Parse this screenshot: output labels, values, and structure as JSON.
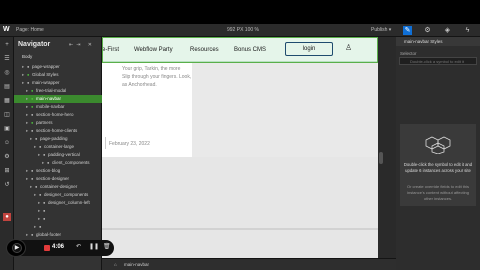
{
  "topbar": {
    "page_label": "Page: Home",
    "sizes": "992 PX  100 %",
    "publish": "Publish ▾"
  },
  "navigator": {
    "title": "Navigator",
    "body_label": "Body",
    "rows": [
      {
        "label": "page-wrapper",
        "dot": "w",
        "depth": 1
      },
      {
        "label": "Global Styles",
        "dot": "g",
        "depth": 1
      },
      {
        "label": "main-wrapper",
        "dot": "w",
        "depth": 1
      },
      {
        "label": "free-trial-modal",
        "dot": "g",
        "depth": 2
      },
      {
        "label": "main-navbar",
        "dot": "g",
        "depth": 2,
        "selected": true
      },
      {
        "label": "mobile-navbar",
        "dot": "g",
        "depth": 2
      },
      {
        "label": "section-home-hero",
        "dot": "w",
        "depth": 2
      },
      {
        "label": "partners",
        "dot": "g",
        "depth": 2
      },
      {
        "label": "section-home-clients",
        "dot": "w",
        "depth": 2
      },
      {
        "label": "page-padding",
        "dot": "w",
        "depth": 3
      },
      {
        "label": "container-large",
        "dot": "w",
        "depth": 4
      },
      {
        "label": "padding-vertical",
        "dot": "w",
        "depth": 5
      },
      {
        "label": "client_components",
        "dot": "w",
        "depth": 6
      },
      {
        "label": "section-blog",
        "dot": "w",
        "depth": 2
      },
      {
        "label": "section-designer",
        "dot": "w",
        "depth": 2
      },
      {
        "label": "container-designer",
        "dot": "w",
        "depth": 3
      },
      {
        "label": "designer_components",
        "dot": "w",
        "depth": 4
      },
      {
        "label": "designer_column-left",
        "dot": "w",
        "depth": 5
      },
      {
        "label": "",
        "dot": "w",
        "depth": 5
      },
      {
        "label": "",
        "dot": "w",
        "depth": 5
      },
      {
        "label": "",
        "dot": "w",
        "depth": 4
      },
      {
        "label": "global-footer",
        "dot": "w",
        "depth": 2
      },
      {
        "label": "Symbol...",
        "dot": "w",
        "depth": 2
      },
      {
        "label": "",
        "dot": "w",
        "depth": 2
      }
    ]
  },
  "site": {
    "links": [
      "e-First",
      "Webflow Party",
      "Resources",
      "Bonus CMS"
    ],
    "login": "login",
    "paragraph_lines": [
      "Your grip, Tarkin, the more",
      "Slip through your fingers. Look,",
      "as Anchorhead."
    ],
    "date": "February 23, 2022"
  },
  "right_panel": {
    "header": "main-navbar Styles",
    "selector_label": "Selector",
    "selector_placeholder": "Double-click a symbol to edit it",
    "info_title": "Double-click the symbol to edit it and update 6 instances across your site",
    "info_sub": "Or create override fields to edit this instance's content without affecting other instances."
  },
  "statusbar": {
    "crumb1": "⌂",
    "crumb2": "main-navbar"
  },
  "recorder": {
    "time": "4:06"
  }
}
